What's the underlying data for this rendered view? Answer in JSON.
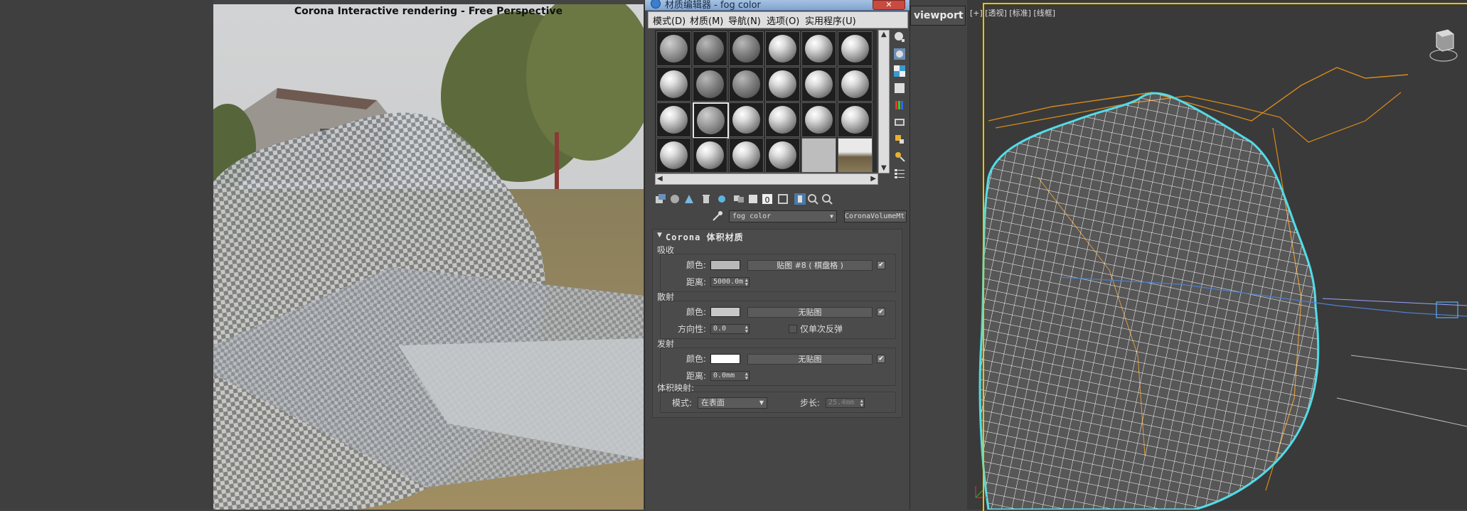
{
  "render_window": {
    "title": "Corona Interactive rendering - Free Perspective"
  },
  "material_editor": {
    "title": "材质编辑器 - fog color",
    "close_label": "✕",
    "menu": [
      {
        "label": "模式(D)"
      },
      {
        "label": "材质(M)"
      },
      {
        "label": "导航(N)"
      },
      {
        "label": "选项(O)"
      },
      {
        "label": "实用程序(U)"
      }
    ],
    "material_name": "fog color",
    "material_type": "CoronaVolumeMtl",
    "rollout_title": "Corona 体积材质",
    "absorption": {
      "group_label": "吸收",
      "color_label": "颜色:",
      "color_value": "#b9b9b9",
      "map_button": "贴图 #8 ( 棋盘格 )",
      "map_enabled": true,
      "distance_label": "距离:",
      "distance_value": "5000.0m"
    },
    "scattering": {
      "group_label": "散射",
      "color_label": "颜色:",
      "color_value": "#c8c8c8",
      "map_button": "无贴图",
      "map_enabled": true,
      "directionality_label": "方向性:",
      "directionality_value": "0.0",
      "single_bounce_label": "仅单次反弹",
      "single_bounce_checked": false
    },
    "emission": {
      "group_label": "发射",
      "color_label": "颜色:",
      "color_value": "#ffffff",
      "map_button": "无贴图",
      "map_enabled": true,
      "distance_label": "距离:",
      "distance_value": "0.0mm"
    },
    "volumetric_mapping": {
      "group_label": "体积映射:",
      "mode_label": "模式:",
      "mode_value": "在表面",
      "step_label": "步长:",
      "step_value": "25.4mm"
    }
  },
  "viewport_button": {
    "label": "viewport"
  },
  "viewport": {
    "label": "[+] [透视] [标准] [线框]"
  }
}
